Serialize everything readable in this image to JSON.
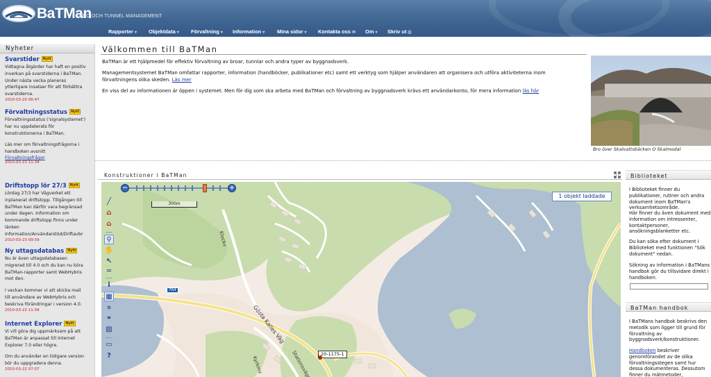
{
  "header": {
    "logo": "BaTMan",
    "subtitle": "BRO OCH TUNNEL MANAGEMENT",
    "nav": [
      {
        "label": "Rapporter"
      },
      {
        "label": "Objektdata"
      },
      {
        "label": "Förvaltning"
      },
      {
        "label": "Information"
      },
      {
        "label": "Mina sidor"
      },
      {
        "label": "Kontakta oss"
      },
      {
        "label": "Om"
      },
      {
        "label": "Skriv ut"
      }
    ]
  },
  "news": {
    "heading": "Nyheter",
    "badge": "Nytt",
    "items": [
      {
        "title": "Svarstider",
        "body": "Vidtagna åtgärder har haft en positiv inverkan på svarstiderna i BaTMan. Under nästa vecka planeras ytterligare insatser för att förbättra svarstiderna.",
        "date": "2010-03-20 06:47"
      },
      {
        "title": "Förvaltningsstatus",
        "body": "Förvaltningsstatus ('signalsystemet') har nu uppdaterats för konstruktionerna i BaTMan.",
        "body2": "Läs mer om förvaltningsfrågorna i handboken avsnitt",
        "link": "Förvaltningsfrågor",
        "date": "2010-03-23 11:34"
      },
      {
        "title": "Driftstopp lör 27/3",
        "body": "Lördag 27/3 har Vägverket ett inplanerat driftstopp. Tillgången till BaTMan kan därför vara begränsad under dagen. Information om kommande driftstopp finns under länken Information/Användarstöd/Driftavbr",
        "date": "2010-03-23 09:59"
      },
      {
        "title": "Ny uttagsdatabas",
        "body": "Nu är även uttagsdatabasen migrerad till 4.0 och du kan nu köra BaTMan-rapporter samt WebHybris mot den.",
        "body2": "I veckan kommer vi att skicka mail till användare av WebHybris och beskriva förändringar i version 4.0.",
        "date": "2010-03-22 11:58"
      },
      {
        "title": "Internet Explorer",
        "body": "Vi vill göra dig uppmärksam på att BaTMan är anpassat till Internet Explorer 7.0 eller högre.",
        "body2": "Om du använder en tidigare version bör du uppgradera denna.",
        "date": "2010-03-22 07:07"
      }
    ]
  },
  "welcome": {
    "heading": "Välkommen till BaTMan",
    "p1": "BaTMan är ett hjälpmedel för effektiv förvaltning av broar, tunnlar och andra typer av byggnadsverk.",
    "p2": "Managementsystemet BaTMan omfattar rapporter, information (handböcker, publikationer etc) samt ett verktyg som hjälper användaren att organisera och utföra aktiviteterna inom förvaltningens olika skeden.",
    "p2_link": "Läs mer",
    "p3": "En viss del av informationen är öppen i systemet. Men för dig som ska arbeta med BaTMan och förvaltning av byggnadsverk krävs ett användarkonto, för mera information",
    "p3_link": "läs här",
    "photo_caption": "Bro över Skalvattsbäcken O Skalmodal"
  },
  "map": {
    "heading": "Konstruktioner i BaTMan",
    "scale": "300m",
    "loaded": "1 objekt laddade",
    "road_number": "764",
    "object_id": "20-1175-1",
    "labels": [
      "Klockv",
      "Gösta Kalles Väg",
      "Stationsvägen",
      "Kyrkmv"
    ],
    "tools": [
      "pan-icon",
      "add-object-icon",
      "remove-object-icon",
      "edit-object-icon",
      "zoom-icon",
      "hand-icon",
      "select-icon",
      "measure-icon",
      "info-icon",
      "grid-icon",
      "layers-icon",
      "binoculars-icon",
      "chart-icon",
      "print-icon",
      "help-icon"
    ]
  },
  "library": {
    "heading": "Biblioteket",
    "p1": "I Biblioteket finner du publikationer, rutiner och andra dokument inom BaTMan's verksamhetsområde.",
    "p2": "Här finner du även dokument med information om intressenter, kontaktpersoner, ansökningsblanketter etc.",
    "p3": "Du kan söka efter dokument i Biblioteket med funktionen \"Sök dokument\" nedan.",
    "p4": "Sökning av information i BaTMans handbok gör du tillsvidare direkt i handboken.",
    "handbook_heading": "BaTMan handbok",
    "h1": "I BaTMans handbok beskrivs den metodik som ligger till grund för förvaltning av byggnadsverk/konstruktioner.",
    "h2_link": "Handboken",
    "h2": "beskriver genomförandet av de olika förvaltningsstegen samt hur dessa dokumenteras. Dessutom finner du mätmetoder, kodförteckningar mm."
  },
  "colors": {
    "header": "#3f6591",
    "link": "#1c3ba0",
    "date": "#c01a1a",
    "badge": "#f2d21a",
    "water": "#adbfd0",
    "land": "#c8dcae"
  }
}
